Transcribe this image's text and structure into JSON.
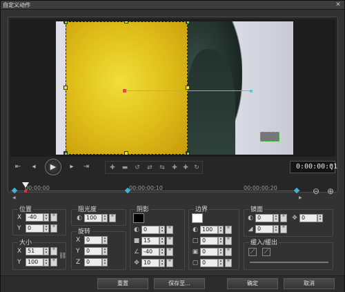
{
  "window": {
    "title": "自定义动作",
    "close": "✕"
  },
  "timecode": "0:00:00:01",
  "ruler": {
    "ticks": [
      "00:00:00",
      "00:00:00:10",
      "00:00:00:20"
    ]
  },
  "position": {
    "title": "位置",
    "x": "-40",
    "y": "0"
  },
  "size": {
    "title": "大小",
    "x": "51",
    "y": "100"
  },
  "opacity": {
    "title": "阻光度",
    "value": "100"
  },
  "rotation": {
    "title": "旋转",
    "x": "0",
    "y": "0",
    "z": "0"
  },
  "shadow": {
    "title": "阴影",
    "v1": "0",
    "v2": "15",
    "v3": "-40",
    "v4": "10",
    "color": "#000000"
  },
  "border": {
    "title": "边界",
    "opacity": "100",
    "v1": "0",
    "v2": "0",
    "v3": "0",
    "color": "#ffffff"
  },
  "mirror": {
    "title": "镜面",
    "v1": "0",
    "v2": "0",
    "v3": "0"
  },
  "ease": {
    "title": "缓入/缓出"
  },
  "axes": {
    "x": "X",
    "y": "Y",
    "z": "Z"
  },
  "buttons": {
    "reset": "重置",
    "saveas": "保存至...",
    "ok": "确定",
    "cancel": "取消"
  },
  "icons": {
    "goto_start": "⇤",
    "prev": "◂",
    "play": "▶",
    "next": "▸",
    "goto_end": "⇥",
    "zoom_out": "⊖",
    "zoom_in": "⊕",
    "move": "✥",
    "link": "⛓"
  }
}
